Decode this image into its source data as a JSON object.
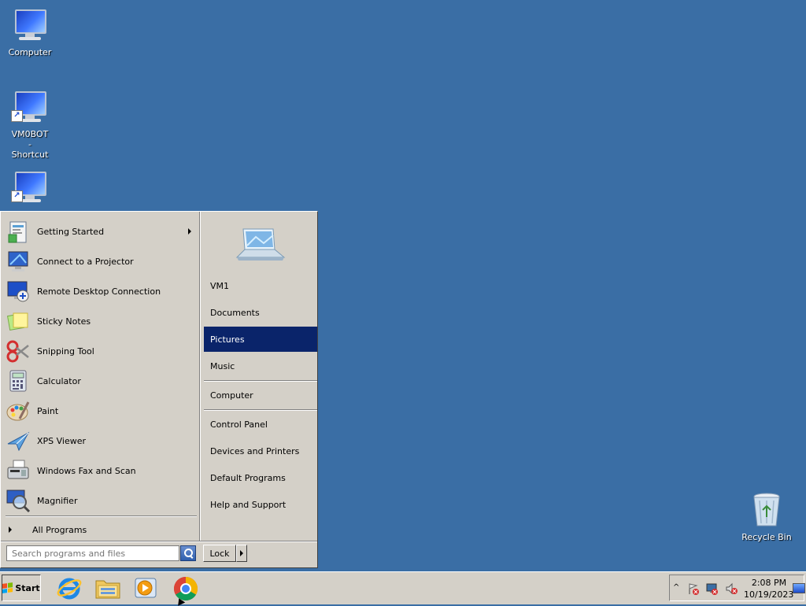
{
  "desktop": {
    "background_color": "#3a6ea5",
    "icons": [
      {
        "label": "Computer",
        "icon": "computer-icon"
      },
      {
        "label": "VM0BOT - Shortcut",
        "icon": "computer-shortcut-icon"
      },
      {
        "label": "",
        "icon": "computer-shortcut-icon"
      },
      {
        "label": "Recycle Bin",
        "icon": "recycle-bin-icon"
      }
    ]
  },
  "start_menu": {
    "programs": [
      {
        "label": "Getting Started",
        "icon": "getting-started-icon",
        "has_submenu": true
      },
      {
        "label": "Connect to a Projector",
        "icon": "projector-icon"
      },
      {
        "label": "Remote Desktop Connection",
        "icon": "remote-desktop-icon"
      },
      {
        "label": "Sticky Notes",
        "icon": "sticky-notes-icon"
      },
      {
        "label": "Snipping Tool",
        "icon": "scissors-icon"
      },
      {
        "label": "Calculator",
        "icon": "calculator-icon"
      },
      {
        "label": "Paint",
        "icon": "paint-palette-icon"
      },
      {
        "label": "XPS Viewer",
        "icon": "xps-viewer-icon"
      },
      {
        "label": "Windows Fax and Scan",
        "icon": "fax-icon"
      },
      {
        "label": "Magnifier",
        "icon": "magnifier-icon"
      }
    ],
    "all_programs_label": "All Programs",
    "right_items": [
      {
        "label": "VM1"
      },
      {
        "label": "Documents"
      },
      {
        "label": "Pictures",
        "selected": true
      },
      {
        "label": "Music"
      },
      {
        "label": "Computer"
      },
      {
        "label": "Control Panel"
      },
      {
        "label": "Devices and Printers"
      },
      {
        "label": "Default Programs"
      },
      {
        "label": "Help and Support"
      }
    ],
    "search_placeholder": "Search programs and files",
    "lock_label": "Lock",
    "selection_color": "#0a246a"
  },
  "taskbar": {
    "start_label": "Start",
    "pinned_apps": [
      {
        "icon": "internet-explorer-icon"
      },
      {
        "icon": "file-explorer-icon"
      },
      {
        "icon": "media-player-icon"
      },
      {
        "icon": "chrome-icon"
      }
    ],
    "tray": {
      "chevron": "^",
      "time": "2:08 PM",
      "date": "10/19/2023"
    }
  }
}
